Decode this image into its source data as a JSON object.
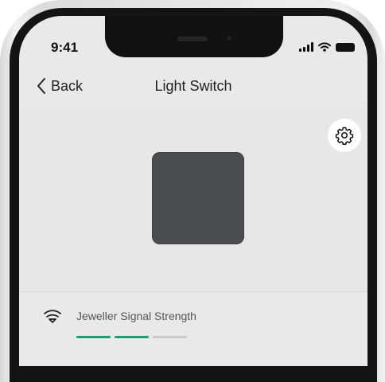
{
  "status_bar": {
    "time": "9:41"
  },
  "navbar": {
    "back_label": "Back",
    "title": "Light Switch"
  },
  "icons": {
    "back": "chevron-left-icon",
    "settings": "gear-icon",
    "signal": "jeweller-signal-icon",
    "cellular": "cellular-signal-icon",
    "wifi": "wifi-icon",
    "battery": "battery-icon"
  },
  "signal_row": {
    "label": "Jeweller Signal Strength",
    "level": 2,
    "max_level": 3,
    "active_color": "#1f9c73",
    "inactive_color": "#c8c8c8"
  }
}
